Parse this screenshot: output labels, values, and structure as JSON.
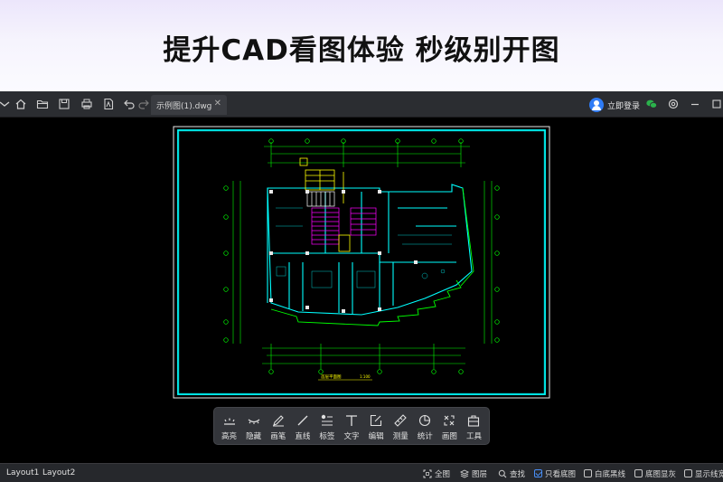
{
  "banner": {
    "title": "提升CAD看图体验  秒级别开图"
  },
  "toolbar": {
    "icons": [
      "menu-icon",
      "home-icon",
      "open-folder-icon",
      "save-icon",
      "print-icon",
      "pdf-icon",
      "undo-icon",
      "redo-icon"
    ],
    "tab": {
      "label": "示例图(1).dwg",
      "close": "✕"
    },
    "login_label": "立即登录",
    "right_icons": [
      "wechat-icon",
      "settings-icon",
      "minimize-icon"
    ]
  },
  "drawing": {
    "title_label": "首层平面图",
    "scale_label": "1:100",
    "colors": {
      "frame": "#00ffff",
      "walls": "#00ffff",
      "dims": "#00ff00",
      "accent": "#ff00ff",
      "stairs": "#ffff00"
    }
  },
  "tools": [
    {
      "label": "高亮",
      "icon": "highlight-icon"
    },
    {
      "label": "隐藏",
      "icon": "hide-icon"
    },
    {
      "label": "画笔",
      "icon": "pen-icon"
    },
    {
      "label": "直线",
      "icon": "line-icon"
    },
    {
      "label": "标签",
      "icon": "tag-icon"
    },
    {
      "label": "文字",
      "icon": "text-icon"
    },
    {
      "label": "编辑",
      "icon": "edit-icon"
    },
    {
      "label": "测量",
      "icon": "ruler-icon"
    },
    {
      "label": "统计",
      "icon": "pie-chart-icon"
    },
    {
      "label": "画图",
      "icon": "draw-shapes-icon"
    },
    {
      "label": "工具",
      "icon": "toolbox-icon"
    }
  ],
  "statusbar": {
    "layouts": [
      "Layout1",
      "Layout2"
    ],
    "items": [
      {
        "label": "全图",
        "icon": "fit-view-icon"
      },
      {
        "label": "图层",
        "icon": "layers-icon"
      },
      {
        "label": "查找",
        "icon": "search-icon"
      }
    ],
    "checks": [
      {
        "label": "只看底图",
        "checked": true
      },
      {
        "label": "白底黑线",
        "checked": false
      },
      {
        "label": "底图显灰",
        "checked": false
      },
      {
        "label": "显示线宽",
        "checked": false
      }
    ]
  }
}
